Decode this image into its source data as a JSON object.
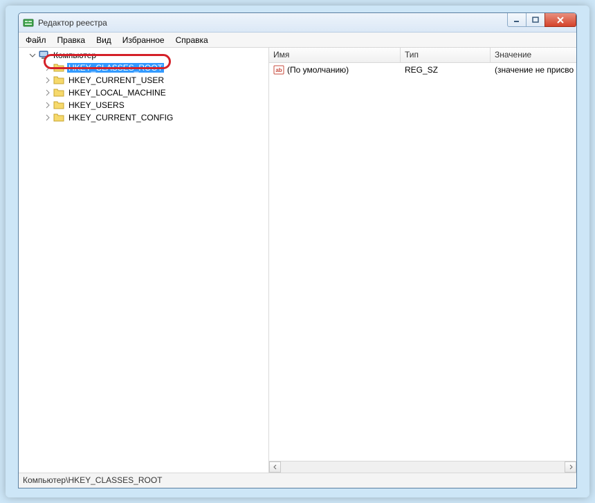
{
  "window": {
    "title": "Редактор реестра"
  },
  "menu": {
    "file": "Файл",
    "edit": "Правка",
    "view": "Вид",
    "favorites": "Избранное",
    "help": "Справка"
  },
  "tree": {
    "root": "Компьютер",
    "items": [
      "HKEY_CLASSES_ROOT",
      "HKEY_CURRENT_USER",
      "HKEY_LOCAL_MACHINE",
      "HKEY_USERS",
      "HKEY_CURRENT_CONFIG"
    ],
    "selected_index": 0
  },
  "list": {
    "columns": {
      "name": "Имя",
      "type": "Тип",
      "value": "Значение"
    },
    "rows": [
      {
        "name": "(По умолчанию)",
        "type": "REG_SZ",
        "value": "(значение не присво"
      }
    ]
  },
  "status": "Компьютер\\HKEY_CLASSES_ROOT"
}
